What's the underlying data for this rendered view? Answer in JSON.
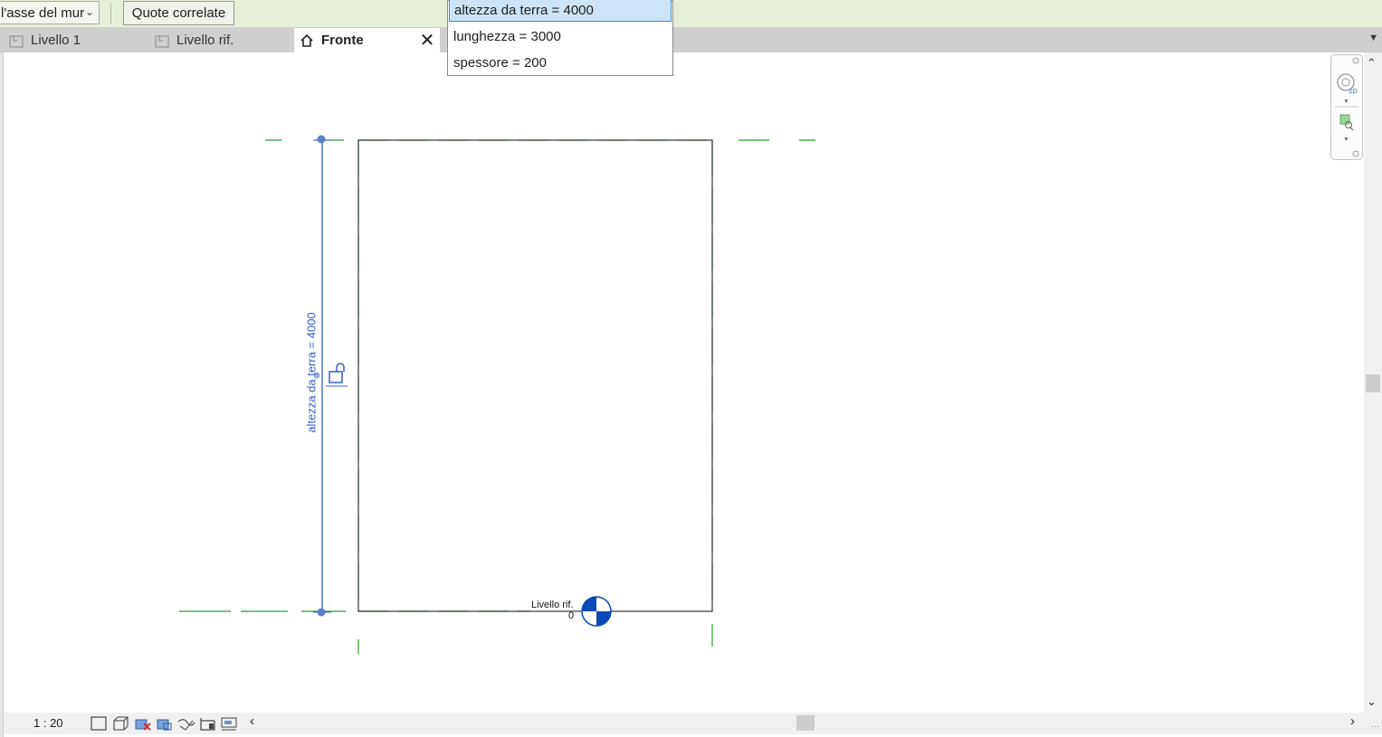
{
  "options_bar": {
    "location_line_value": "l'asse del mur",
    "related_dimensions_button": "Quote correlate"
  },
  "tabs": [
    {
      "label": "Livello 1",
      "icon": "floor-plan-icon",
      "active": false
    },
    {
      "label": "Livello rif.",
      "icon": "floor-plan-icon",
      "active": false
    },
    {
      "label": "Fronte",
      "icon": "elevation-house-icon",
      "active": true
    }
  ],
  "dropdown": {
    "items": [
      {
        "label": "altezza da terra = 4000",
        "selected": true
      },
      {
        "label": "lunghezza = 3000",
        "selected": false
      },
      {
        "label": "spessore = 200",
        "selected": false
      }
    ]
  },
  "canvas": {
    "dimension_label": "altezza da terra = 4000",
    "level_name": "Livello rif.",
    "level_elevation": "0"
  },
  "status_bar": {
    "scale": "1 : 20"
  },
  "colors": {
    "options_bar_bg": "#e6efd9",
    "dimension_blue": "#3a5fc4",
    "reference_green": "#2e9b2e",
    "selection_blue": "#cce4f7",
    "level_marker_blue": "#0a49b8"
  }
}
